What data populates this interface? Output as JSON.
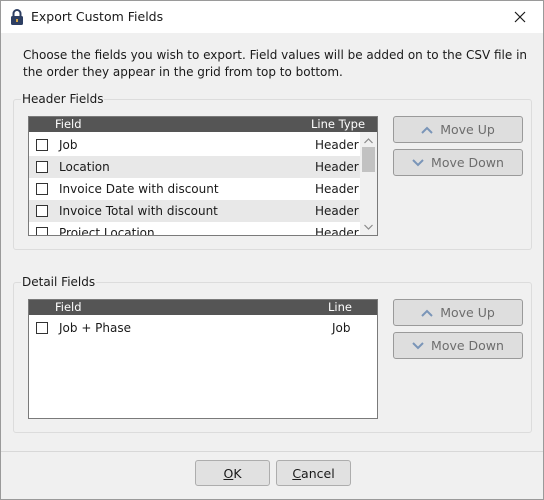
{
  "window": {
    "title": "Export Custom Fields"
  },
  "description": "Choose the fields you wish to export. Field values will be added on to the CSV file in the order they appear in the grid from top to bottom.",
  "header_fields": {
    "group_label": "Header Fields",
    "columns": {
      "field": "Field",
      "line_type": "Line Type"
    },
    "rows": [
      {
        "field": "Job",
        "line_type": "Header",
        "checked": false
      },
      {
        "field": "Location",
        "line_type": "Header",
        "checked": false
      },
      {
        "field": "Invoice Date with discount",
        "line_type": "Header",
        "checked": false
      },
      {
        "field": "Invoice Total with discount",
        "line_type": "Header",
        "checked": false
      },
      {
        "field": "Project Location",
        "line_type": "Header",
        "checked": false
      }
    ],
    "move_up_label": "Move Up",
    "move_down_label": "Move Down"
  },
  "detail_fields": {
    "group_label": "Detail Fields",
    "columns": {
      "field": "Field",
      "line_type": "Line Type"
    },
    "rows": [
      {
        "field": "Job + Phase",
        "line_type": "Job",
        "checked": false
      }
    ],
    "move_up_label": "Move Up",
    "move_down_label": "Move Down"
  },
  "footer": {
    "ok_label": "OK",
    "ok_mnemonic": "O",
    "ok_rest": "K",
    "cancel_label": "Cancel",
    "cancel_mnemonic": "C",
    "cancel_rest": "ancel"
  },
  "colors": {
    "grid_header": "#555555",
    "row_alt": "#e8e8e8",
    "disabled_button": "#dedede"
  },
  "icons": [
    "lock-icon",
    "close-icon",
    "chevron-up-icon",
    "chevron-down-icon",
    "scroll-up-arrow-icon",
    "scroll-down-arrow-icon"
  ]
}
